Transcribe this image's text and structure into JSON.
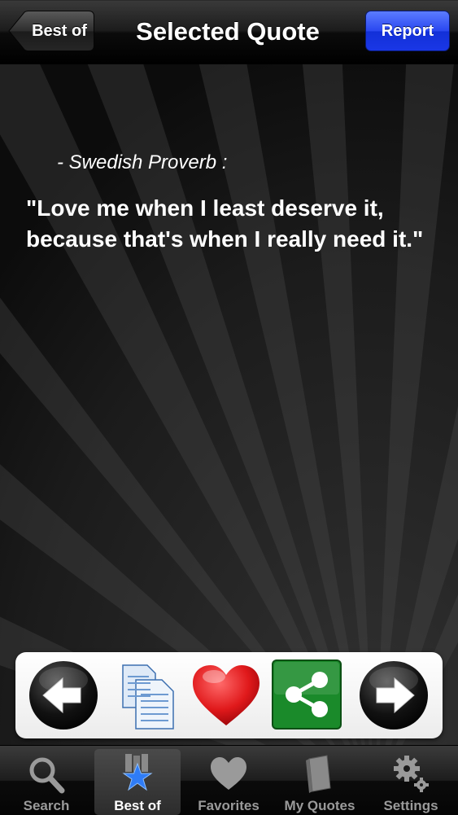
{
  "nav": {
    "back_label": "Best of",
    "title": "Selected Quote",
    "report_label": "Report"
  },
  "quote": {
    "author": "- Swedish Proverb :",
    "text": "\"Love me when I least deserve it, because that's when I really need it.\""
  },
  "toolbar": {
    "icons": [
      "previous-arrow-icon",
      "copy-documents-icon",
      "heart-icon",
      "share-icon",
      "next-arrow-icon"
    ]
  },
  "tabs": [
    {
      "label": "Search",
      "icon": "magnifier-icon"
    },
    {
      "label": "Best of",
      "icon": "star-books-icon",
      "active": true
    },
    {
      "label": "Favorites",
      "icon": "heart-icon"
    },
    {
      "label": "My Quotes",
      "icon": "book-icon"
    },
    {
      "label": "Settings",
      "icon": "gears-icon"
    }
  ],
  "colors": {
    "report_button": "#2a47f0",
    "share_green": "#1a8a2a",
    "heart_red": "#e0191b",
    "star_blue": "#2f7cf6"
  }
}
